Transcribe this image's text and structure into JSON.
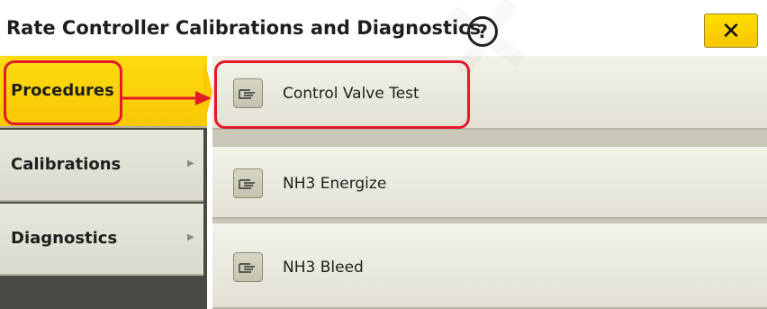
{
  "header": {
    "title": "Rate Controller Calibrations and Diagnostics",
    "help_label": "?",
    "close_label": "✕"
  },
  "sidebar": {
    "items": [
      {
        "label": "Procedures",
        "active": true
      },
      {
        "label": "Calibrations",
        "active": false
      },
      {
        "label": "Diagnostics",
        "active": false
      }
    ]
  },
  "procedures": {
    "rows": [
      {
        "label": "Control Valve Test",
        "icon": "hand-pointer-icon"
      },
      {
        "label": "NH3 Energize",
        "icon": "hand-pointer-icon"
      },
      {
        "label": "NH3 Bleed",
        "icon": "hand-pointer-icon"
      }
    ]
  },
  "annotation": {
    "highlight_color": "#e21b2b"
  }
}
